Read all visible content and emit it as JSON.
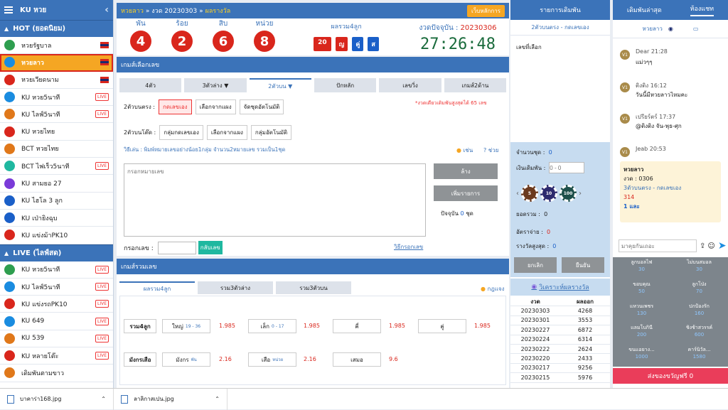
{
  "sidebar": {
    "brand": "KU หวย",
    "hot_label": "HOT (ยอดนิยม)",
    "live_label": "LIVE (ไลฟ์สด)",
    "hot_items": [
      {
        "label": "หวยรัฐบาล",
        "badge": "flag"
      },
      {
        "label": "หวยลาว",
        "badge": "flag"
      },
      {
        "label": "หวยเวียดนาม",
        "badge": "flag"
      },
      {
        "label": "KU หวย5นาที",
        "badge": "LIVE"
      },
      {
        "label": "KU ไลฟ์5นาที",
        "badge": "LIVE"
      },
      {
        "label": "KU หวยไทย",
        "badge": ""
      },
      {
        "label": "BCT หวยไทย",
        "badge": ""
      },
      {
        "label": "BCT ไฟเร็ว5นาที",
        "badge": "LIVE"
      },
      {
        "label": "KU สามยอ 27",
        "badge": ""
      },
      {
        "label": "KU ไฮโล 3 ลูก",
        "badge": ""
      },
      {
        "label": "KU เป่ายิงฉุบ",
        "badge": ""
      },
      {
        "label": "KU แข่งม้าPK10",
        "badge": ""
      }
    ],
    "live_items": [
      {
        "label": "KU หวย5นาที",
        "badge": "LIVE"
      },
      {
        "label": "KU ไลฟ์5นาที",
        "badge": "LIVE"
      },
      {
        "label": "KU แข่งรถPK10",
        "badge": "LIVE"
      },
      {
        "label": "KU 649",
        "badge": "LIVE"
      },
      {
        "label": "KU 539",
        "badge": "LIVE"
      },
      {
        "label": "KU หลายโต๊ะ",
        "badge": "LIVE"
      },
      {
        "label": "เดิมพันตามขาว",
        "badge": ""
      }
    ]
  },
  "topbar": {
    "game": "หวยลาว",
    "draw_text": "» งวด 20230303 »",
    "result_link": "ผลรางวัล",
    "back_button": "เว็บหลักการ"
  },
  "digits": {
    "labels": [
      "พัน",
      "ร้อย",
      "สิบ",
      "หน่วย"
    ],
    "values": [
      "4",
      "2",
      "6",
      "8"
    ],
    "sum_label": "ผลรวม4ลูก",
    "sum_value": "20",
    "sum_tags": [
      "ญ",
      "คู่",
      "ส"
    ],
    "current_draw_label": "งวดปัจจุบัน :",
    "current_draw": "20230306",
    "countdown": "27:26:48"
  },
  "game_section": {
    "title": "เกมส์เลือกเลข",
    "tabs": [
      "4ตัว",
      "3ตัวล่าง ▼",
      "2ตัวบน ▼",
      "ปักหลัก",
      "เลขวิ่ง",
      "เกมส์2ด้าน"
    ],
    "row1_label": "2ตัวบนตรง :",
    "row1_buttons": [
      "กดเลขเอง",
      "เลือกจากแผง",
      "จัดชุดอัตโนมัติ"
    ],
    "row1_note": "*งวดเดียวเดิมพันสูงสุดได้ 65 เลข",
    "row2_label": "2ตัวบนโต๊ด :",
    "row2_buttons": [
      "กลุ่มกดเลขเอง",
      "เลือกจากแผง",
      "กลุ่มอัตโนมัติ"
    ],
    "howto": "วิธีเล่น : พิมพ์หมายเลขอย่างน้อย1กลุ่ม จำนวน2หมายเลข รวมเป็น1ชุด",
    "example": "เช่น",
    "help": "ช่วย",
    "textarea_placeholder": "กรอกหมายเลข",
    "clear_button": "ล้าง",
    "add_button": "เพิ่มรายการ",
    "current_label": "ปัจจุบัน",
    "current_count": "0",
    "current_unit": "ชุด",
    "input_label": "กรอกเลข :",
    "reverse_button": "กลับเลข",
    "input_howto": "วิธีกรอกเลข"
  },
  "sum_section": {
    "title": "เกมส์รวมเลข",
    "tabs": [
      "ผลรวม4ลูก",
      "รวม3ตัวล่าง",
      "รวม3ตัวบน"
    ],
    "rules": "กฎแจง",
    "row1": {
      "label": "รวม4ลูก",
      "opts": [
        {
          "name": "ใหญ่",
          "range": "19 - 36",
          "rate": "1.985"
        },
        {
          "name": "เล็ก",
          "range": "0 - 17",
          "rate": "1.985"
        },
        {
          "name": "คี่",
          "range": "",
          "rate": "1.985"
        },
        {
          "name": "คู่",
          "range": "",
          "rate": "1.985"
        }
      ]
    },
    "row2": {
      "label": "มังกรเสือ",
      "opts": [
        {
          "name": "มังกร",
          "range": "พัน",
          "rate": "2.16"
        },
        {
          "name": "เสือ",
          "range": "หน่วย",
          "rate": "2.16"
        },
        {
          "name": "เสมอ",
          "range": "",
          "rate": "9.6"
        }
      ]
    }
  },
  "bets": {
    "title": "รายการเดิมพัน",
    "type_link": "2ตัวบนตรง - กดเลขเอง",
    "selected_label": "เลขที่เลือก",
    "sets_label": "จำนวนชุด :",
    "sets_value": "0",
    "amount_label": "เงินเดิมพัน :",
    "amount_placeholder": "0 - 0",
    "chips": [
      "5",
      "10",
      "100"
    ],
    "total_label": "ยอดรวม :",
    "total_value": "0",
    "payout_label": "อัตราจ่าย :",
    "payout_value": "0",
    "max_label": "รางวัลสูงสุด :",
    "max_value": "0",
    "cancel_button": "ยกเลิก",
    "confirm_button": "ยืนยัน",
    "analyze_link": "วิเคราะห์ผลรางวัล",
    "results_head": [
      "งวด",
      "ผลออก"
    ],
    "results": [
      [
        "20230303",
        "4268"
      ],
      [
        "20230301",
        "3553"
      ],
      [
        "20230227",
        "6872"
      ],
      [
        "20230224",
        "6314"
      ],
      [
        "20230222",
        "2624"
      ],
      [
        "20230220",
        "2433"
      ],
      [
        "20230217",
        "9256"
      ],
      [
        "20230215",
        "5976"
      ]
    ]
  },
  "chat": {
    "tabs": [
      "เดิมพันล่าสุด",
      "ห้องแชท"
    ],
    "room": "หวยลาว",
    "messages": [
      {
        "user": "Dear 21:28",
        "text": "แม่วๆๆ"
      },
      {
        "user": "ติงติง 16:12",
        "text": "วันนี้มีหวยลาวไหมคะ"
      },
      {
        "user": "เปรียร์ตร์ 17:37",
        "text": "@ติงติง จัน-พุธ-ศุก"
      },
      {
        "user": "Jeab 20:53",
        "text": ""
      }
    ],
    "card": {
      "title": "หวยลาว",
      "draw": "งวด : 0306",
      "type": "3ตัวบนตรง - กดเลขเอง",
      "number": "314",
      "amount": "1 และ"
    },
    "input_placeholder": "มาคุยกันเถอะ",
    "grid": [
      [
        "ลูกบอลไฟ",
        "30"
      ],
      [
        "ไม่บนสมอล",
        "30"
      ],
      [
        "ขอบคุณ",
        "50"
      ],
      [
        "ลูกโป่ง",
        "70"
      ],
      [
        "แหวนเพชร",
        "130"
      ],
      [
        "ปกป้องรัก",
        "160"
      ],
      [
        "แลมโบกินี",
        "200"
      ],
      [
        "ชิงช้าสวรรค์",
        "600"
      ],
      [
        "ขนแอยาง...",
        "1000"
      ],
      [
        "คาร์นิวัล...",
        "1580"
      ]
    ],
    "gift_bar": "ส่งของขวัญฟรี 0"
  },
  "downloads": [
    {
      "name": "บาคาร่า168.jpg"
    },
    {
      "name": "ลาลิกาสเปน.jpg"
    }
  ]
}
